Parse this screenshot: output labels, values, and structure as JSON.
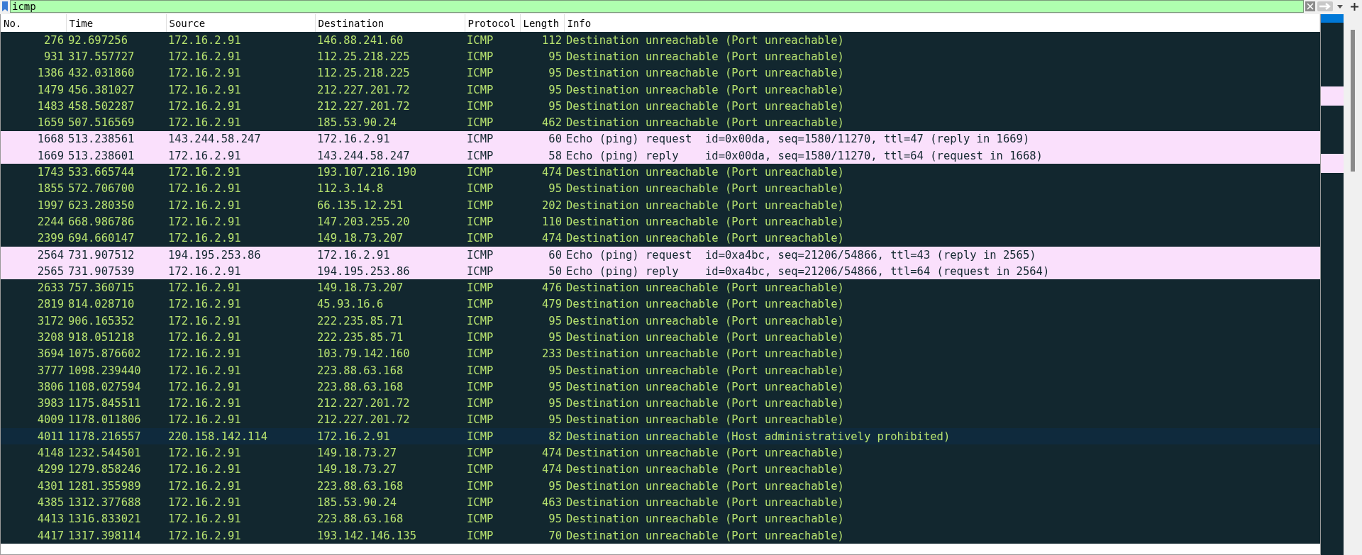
{
  "filter": {
    "value": "icmp"
  },
  "table": {
    "columns": [
      "No.",
      "Time",
      "Source",
      "Destination",
      "Protocol",
      "Length",
      "Info"
    ],
    "rows": [
      {
        "kind": "unreachable",
        "cells": [
          "276",
          "92.697256",
          "172.16.2.91",
          "146.88.241.60",
          "ICMP",
          "112",
          "Destination unreachable (Port unreachable)"
        ]
      },
      {
        "kind": "unreachable",
        "cells": [
          "931",
          "317.557727",
          "172.16.2.91",
          "112.25.218.225",
          "ICMP",
          "95",
          "Destination unreachable (Port unreachable)"
        ]
      },
      {
        "kind": "unreachable",
        "cells": [
          "1386",
          "432.031860",
          "172.16.2.91",
          "112.25.218.225",
          "ICMP",
          "95",
          "Destination unreachable (Port unreachable)"
        ]
      },
      {
        "kind": "unreachable",
        "cells": [
          "1479",
          "456.381027",
          "172.16.2.91",
          "212.227.201.72",
          "ICMP",
          "95",
          "Destination unreachable (Port unreachable)"
        ]
      },
      {
        "kind": "unreachable",
        "cells": [
          "1483",
          "458.502287",
          "172.16.2.91",
          "212.227.201.72",
          "ICMP",
          "95",
          "Destination unreachable (Port unreachable)"
        ]
      },
      {
        "kind": "unreachable",
        "cells": [
          "1659",
          "507.516569",
          "172.16.2.91",
          "185.53.90.24",
          "ICMP",
          "462",
          "Destination unreachable (Port unreachable)"
        ]
      },
      {
        "kind": "ping",
        "cells": [
          "1668",
          "513.238561",
          "143.244.58.247",
          "172.16.2.91",
          "ICMP",
          "60",
          "Echo (ping) request  id=0x00da, seq=1580/11270, ttl=47 (reply in 1669)"
        ]
      },
      {
        "kind": "ping",
        "cells": [
          "1669",
          "513.238601",
          "172.16.2.91",
          "143.244.58.247",
          "ICMP",
          "58",
          "Echo (ping) reply    id=0x00da, seq=1580/11270, ttl=64 (request in 1668)"
        ]
      },
      {
        "kind": "unreachable",
        "cells": [
          "1743",
          "533.665744",
          "172.16.2.91",
          "193.107.216.190",
          "ICMP",
          "474",
          "Destination unreachable (Port unreachable)"
        ]
      },
      {
        "kind": "unreachable",
        "cells": [
          "1855",
          "572.706700",
          "172.16.2.91",
          "112.3.14.8",
          "ICMP",
          "95",
          "Destination unreachable (Port unreachable)"
        ]
      },
      {
        "kind": "unreachable",
        "cells": [
          "1997",
          "623.280350",
          "172.16.2.91",
          "66.135.12.251",
          "ICMP",
          "202",
          "Destination unreachable (Port unreachable)"
        ]
      },
      {
        "kind": "unreachable",
        "cells": [
          "2244",
          "668.986786",
          "172.16.2.91",
          "147.203.255.20",
          "ICMP",
          "110",
          "Destination unreachable (Port unreachable)"
        ]
      },
      {
        "kind": "unreachable",
        "cells": [
          "2399",
          "694.660147",
          "172.16.2.91",
          "149.18.73.207",
          "ICMP",
          "474",
          "Destination unreachable (Port unreachable)"
        ]
      },
      {
        "kind": "ping",
        "cells": [
          "2564",
          "731.907512",
          "194.195.253.86",
          "172.16.2.91",
          "ICMP",
          "60",
          "Echo (ping) request  id=0xa4bc, seq=21206/54866, ttl=43 (reply in 2565)"
        ]
      },
      {
        "kind": "ping",
        "cells": [
          "2565",
          "731.907539",
          "172.16.2.91",
          "194.195.253.86",
          "ICMP",
          "50",
          "Echo (ping) reply    id=0xa4bc, seq=21206/54866, ttl=64 (request in 2564)"
        ]
      },
      {
        "kind": "unreachable",
        "cells": [
          "2633",
          "757.360715",
          "172.16.2.91",
          "149.18.73.207",
          "ICMP",
          "476",
          "Destination unreachable (Port unreachable)"
        ]
      },
      {
        "kind": "unreachable",
        "cells": [
          "2819",
          "814.028710",
          "172.16.2.91",
          "45.93.16.6",
          "ICMP",
          "479",
          "Destination unreachable (Port unreachable)"
        ]
      },
      {
        "kind": "unreachable",
        "cells": [
          "3172",
          "906.165352",
          "172.16.2.91",
          "222.235.85.71",
          "ICMP",
          "95",
          "Destination unreachable (Port unreachable)"
        ]
      },
      {
        "kind": "unreachable",
        "cells": [
          "3208",
          "918.051218",
          "172.16.2.91",
          "222.235.85.71",
          "ICMP",
          "95",
          "Destination unreachable (Port unreachable)"
        ]
      },
      {
        "kind": "unreachable",
        "cells": [
          "3694",
          "1075.876602",
          "172.16.2.91",
          "103.79.142.160",
          "ICMP",
          "233",
          "Destination unreachable (Port unreachable)"
        ]
      },
      {
        "kind": "unreachable",
        "cells": [
          "3777",
          "1098.239440",
          "172.16.2.91",
          "223.88.63.168",
          "ICMP",
          "95",
          "Destination unreachable (Port unreachable)"
        ]
      },
      {
        "kind": "unreachable",
        "cells": [
          "3806",
          "1108.027594",
          "172.16.2.91",
          "223.88.63.168",
          "ICMP",
          "95",
          "Destination unreachable (Port unreachable)"
        ]
      },
      {
        "kind": "unreachable",
        "cells": [
          "3983",
          "1175.845511",
          "172.16.2.91",
          "212.227.201.72",
          "ICMP",
          "95",
          "Destination unreachable (Port unreachable)"
        ]
      },
      {
        "kind": "unreachable",
        "cells": [
          "4009",
          "1178.011806",
          "172.16.2.91",
          "212.227.201.72",
          "ICMP",
          "95",
          "Destination unreachable (Port unreachable)"
        ]
      },
      {
        "kind": "prohibited",
        "cells": [
          "4011",
          "1178.216557",
          "220.158.142.114",
          "172.16.2.91",
          "ICMP",
          "82",
          "Destination unreachable (Host administratively prohibited)"
        ]
      },
      {
        "kind": "unreachable",
        "cells": [
          "4148",
          "1232.544501",
          "172.16.2.91",
          "149.18.73.27",
          "ICMP",
          "474",
          "Destination unreachable (Port unreachable)"
        ]
      },
      {
        "kind": "unreachable",
        "cells": [
          "4299",
          "1279.858246",
          "172.16.2.91",
          "149.18.73.27",
          "ICMP",
          "474",
          "Destination unreachable (Port unreachable)"
        ]
      },
      {
        "kind": "unreachable",
        "cells": [
          "4301",
          "1281.355989",
          "172.16.2.91",
          "223.88.63.168",
          "ICMP",
          "95",
          "Destination unreachable (Port unreachable)"
        ]
      },
      {
        "kind": "unreachable",
        "cells": [
          "4385",
          "1312.377688",
          "172.16.2.91",
          "185.53.90.24",
          "ICMP",
          "463",
          "Destination unreachable (Port unreachable)"
        ]
      },
      {
        "kind": "unreachable",
        "cells": [
          "4413",
          "1316.833021",
          "172.16.2.91",
          "223.88.63.168",
          "ICMP",
          "95",
          "Destination unreachable (Port unreachable)"
        ]
      },
      {
        "kind": "unreachable",
        "cells": [
          "4417",
          "1317.398114",
          "172.16.2.91",
          "193.142.146.135",
          "ICMP",
          "70",
          "Destination unreachable (Port unreachable)"
        ]
      }
    ]
  }
}
